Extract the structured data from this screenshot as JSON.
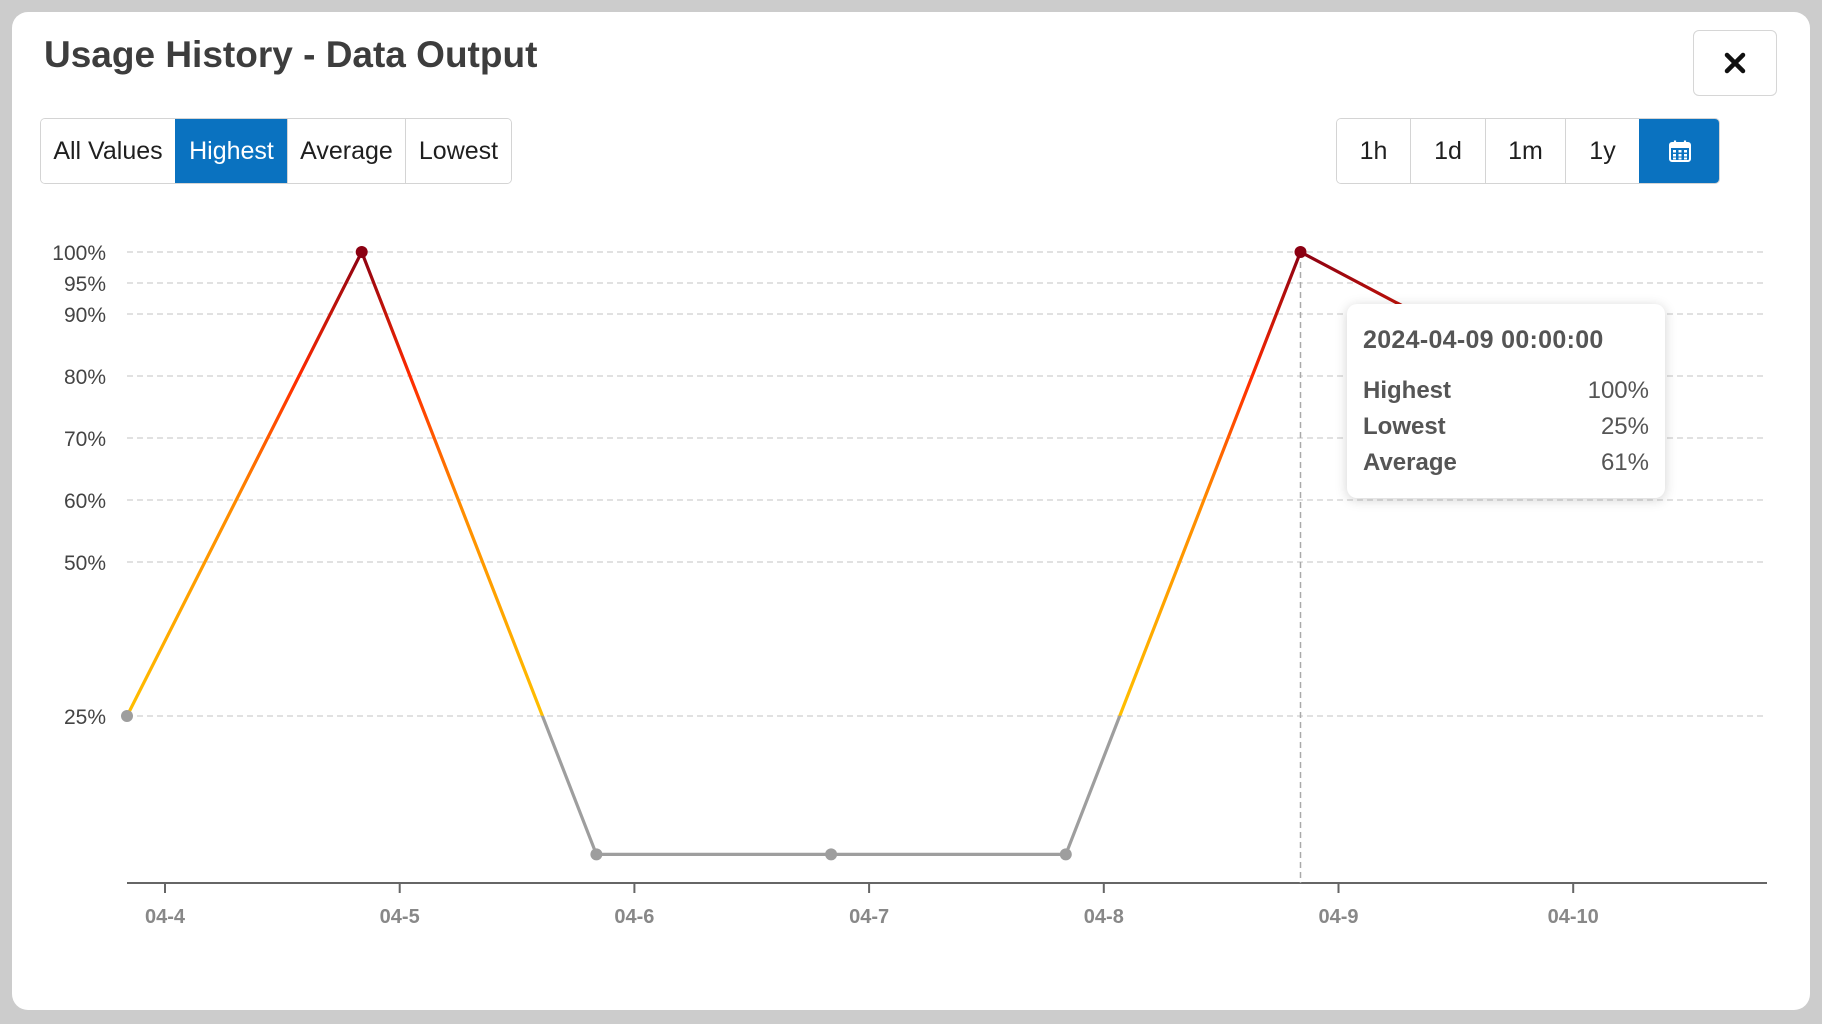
{
  "dialog": {
    "title": "Usage History - Data Output",
    "close_icon": "close-x-icon"
  },
  "filters": [
    {
      "label": "All Values",
      "active": false
    },
    {
      "label": "Highest",
      "active": true
    },
    {
      "label": "Average",
      "active": false
    },
    {
      "label": "Lowest",
      "active": false
    }
  ],
  "ranges": [
    {
      "label": "1h",
      "active": false
    },
    {
      "label": "1d",
      "active": false
    },
    {
      "label": "1m",
      "active": false
    },
    {
      "label": "1y",
      "active": false
    },
    {
      "label": "",
      "icon": "calendar-icon",
      "active": true
    }
  ],
  "colors": {
    "accent": "#0a72c0",
    "low": "#9e9e9e",
    "mid": "#ffbf00",
    "high": "#ff2a00",
    "peak": "#8b0012"
  },
  "chart_data": {
    "type": "line",
    "x": [
      "2024-04-04 00:00:00",
      "2024-04-05 00:00:00",
      "2024-04-06 00:00:00",
      "2024-04-07 00:00:00",
      "2024-04-08 00:00:00",
      "2024-04-09 00:00:00",
      "2024-04-10 00:00:00"
    ],
    "series": [
      {
        "name": "Highest",
        "values": [
          25,
          100,
          5,
          5,
          5,
          100,
          80
        ]
      }
    ],
    "x_tick_labels": [
      "04-4",
      "04-5",
      "04-6",
      "04-7",
      "04-8",
      "04-9",
      "04-10"
    ],
    "y_tick_values": [
      25,
      50,
      60,
      70,
      80,
      90,
      95,
      100
    ],
    "y_tick_labels": [
      "25%",
      "50%",
      "60%",
      "70%",
      "80%",
      "90%",
      "95%",
      "100%"
    ],
    "ylim": [
      0,
      100
    ],
    "grid": true,
    "hover_date": "2024-04-09 00:00:00"
  },
  "tooltip": {
    "date": "2024-04-09 00:00:00",
    "rows": [
      {
        "label": "Highest",
        "value": "100%"
      },
      {
        "label": "Lowest",
        "value": "25%"
      },
      {
        "label": "Average",
        "value": "61%"
      }
    ]
  }
}
